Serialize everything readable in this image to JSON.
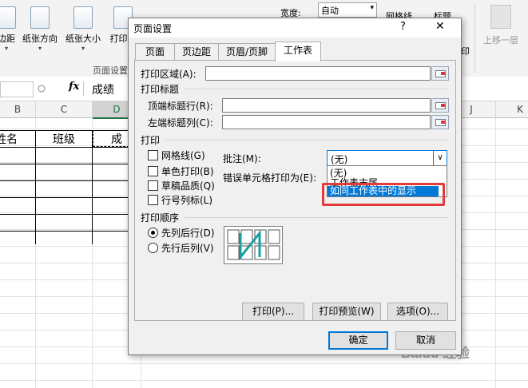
{
  "ribbon": {
    "buttons": [
      "边距",
      "纸张方向",
      "纸张大小",
      "打印区"
    ],
    "group_label": "页面设置",
    "width_label": "宽度:",
    "width_value": "自动",
    "gridlines_label": "网格线",
    "headings_label": "标题",
    "print_label": "印",
    "move_up_label": "上移一层"
  },
  "formula_bar": {
    "fx": "fx",
    "content": "成绩"
  },
  "sheet": {
    "columns": [
      "B",
      "C",
      "D",
      "J",
      "K"
    ],
    "cells": [
      "姓名",
      "班级",
      "成绩"
    ]
  },
  "dialog": {
    "title": "页面设置",
    "help": "?",
    "close": "✕",
    "tabs": [
      "页面",
      "页边距",
      "页眉/页脚",
      "工作表"
    ],
    "print_area_label": "打印区域(A):",
    "print_titles_label": "打印标题",
    "rows_to_repeat_label": "顶端标题行(R):",
    "cols_to_repeat_label": "左端标题列(C):",
    "print_section_label": "打印",
    "checkboxes": [
      "网格线(G)",
      "单色打印(B)",
      "草稿品质(Q)",
      "行号列标(L)"
    ],
    "comments_label": "批注(M):",
    "comments_value": "(无)",
    "errors_label": "错误单元格打印为(E):",
    "dropdown_options": [
      "(无)",
      "工作表末尾",
      "如同工作表中的显示"
    ],
    "page_order_label": "打印顺序",
    "page_order_options": [
      "先列后行(D)",
      "先行后列(V)"
    ],
    "buttons": [
      "打印(P)...",
      "打印预览(W)",
      "选项(O)..."
    ],
    "ok": "确定",
    "cancel": "取消"
  },
  "colors": {
    "excel_green": "#217346",
    "highlight_red": "#e23b3b",
    "selection_blue": "#0078d7"
  },
  "watermark": "Baidu 经验"
}
